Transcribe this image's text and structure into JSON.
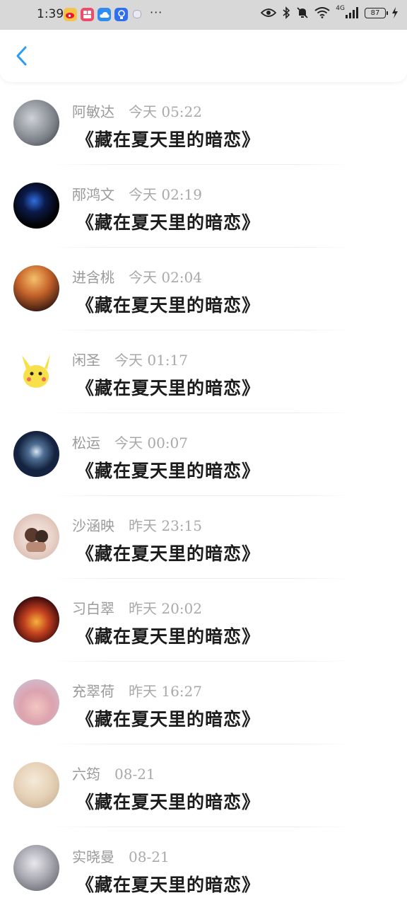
{
  "status_bar": {
    "time": "1:39",
    "dots": "···",
    "network": "4G",
    "battery": "87"
  },
  "header": {
    "back_icon": "chevron-left-icon"
  },
  "items": [
    {
      "name": "阿敏达",
      "time": "今天 05:22",
      "title": "《藏在夏天里的暗恋》"
    },
    {
      "name": "邴鸿文",
      "time": "今天 02:19",
      "title": "《藏在夏天里的暗恋》"
    },
    {
      "name": "进含桃",
      "time": "今天 02:04",
      "title": "《藏在夏天里的暗恋》"
    },
    {
      "name": "闲圣",
      "time": "今天 01:17",
      "title": "《藏在夏天里的暗恋》"
    },
    {
      "name": "松运",
      "time": "今天 00:07",
      "title": "《藏在夏天里的暗恋》"
    },
    {
      "name": "沙涵映",
      "time": "昨天 23:15",
      "title": "《藏在夏天里的暗恋》"
    },
    {
      "name": "习白翠",
      "time": "昨天 20:02",
      "title": "《藏在夏天里的暗恋》"
    },
    {
      "name": "充翠荷",
      "time": "昨天 16:27",
      "title": "《藏在夏天里的暗恋》"
    },
    {
      "name": "六筠",
      "time": "08-21",
      "title": "《藏在夏天里的暗恋》"
    },
    {
      "name": "实晓曼",
      "time": "08-21",
      "title": "《藏在夏天里的暗恋》"
    }
  ]
}
